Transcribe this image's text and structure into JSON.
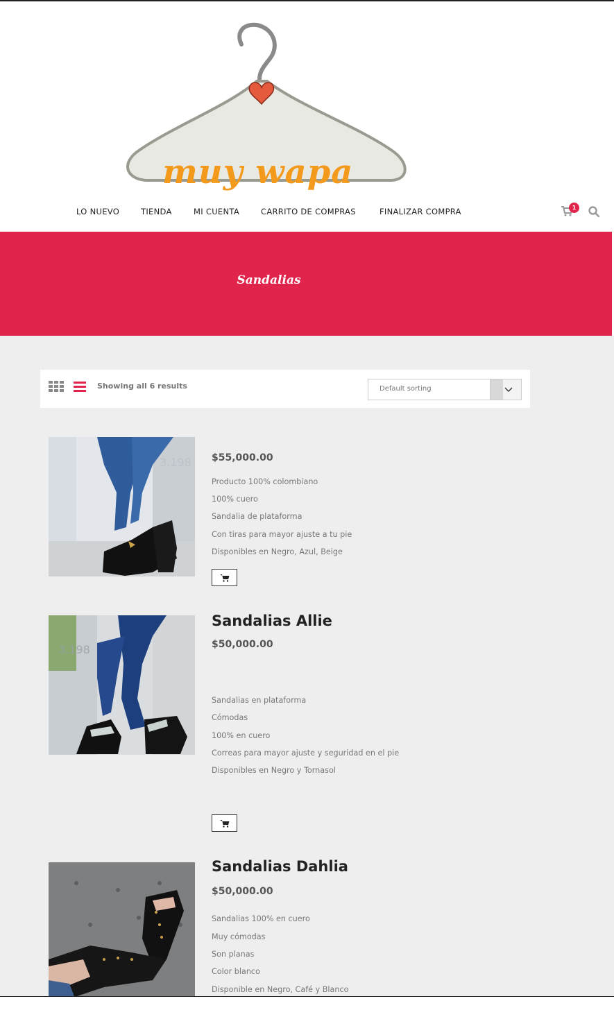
{
  "brand": {
    "logo_text": "muy wapa"
  },
  "nav": {
    "items": [
      "LO NUEVO",
      "TIENDA",
      "MI CUENTA",
      "CARRITO DE COMPRAS",
      "FINALIZAR COMPRA"
    ],
    "cart_count": "1"
  },
  "hero": {
    "title": "Sandalias"
  },
  "toolbar": {
    "result_count": "Showing all 6 results",
    "sort_selected": "Default sorting"
  },
  "products": [
    {
      "title": "",
      "price": "$55,000.00",
      "description": [
        "Producto 100% colombiano",
        "100% cuero",
        "Sandalia de plataforma",
        "Con tiras para mayor ajuste a tu pie",
        "Disponibles en Negro, Azul, Beige"
      ]
    },
    {
      "title": "Sandalias Allie",
      "price": "$50,000.00",
      "description": [
        "Sandalias en plataforma",
        "Cómodas",
        "100% en cuero",
        "Correas para mayor ajuste y seguridad en el pie",
        "Disponibles en Negro y Tornasol"
      ]
    },
    {
      "title": "Sandalias Dahlia",
      "price": "$50,000.00",
      "description": [
        "Sandalias 100% en cuero",
        "Muy cómodas",
        "Son planas",
        "Color blanco",
        "Disponible en Negro, Café y Blanco"
      ]
    }
  ],
  "colors": {
    "accent": "#e0244c",
    "logo_orange": "#f39a1c",
    "content_bg": "#eeeeee"
  }
}
